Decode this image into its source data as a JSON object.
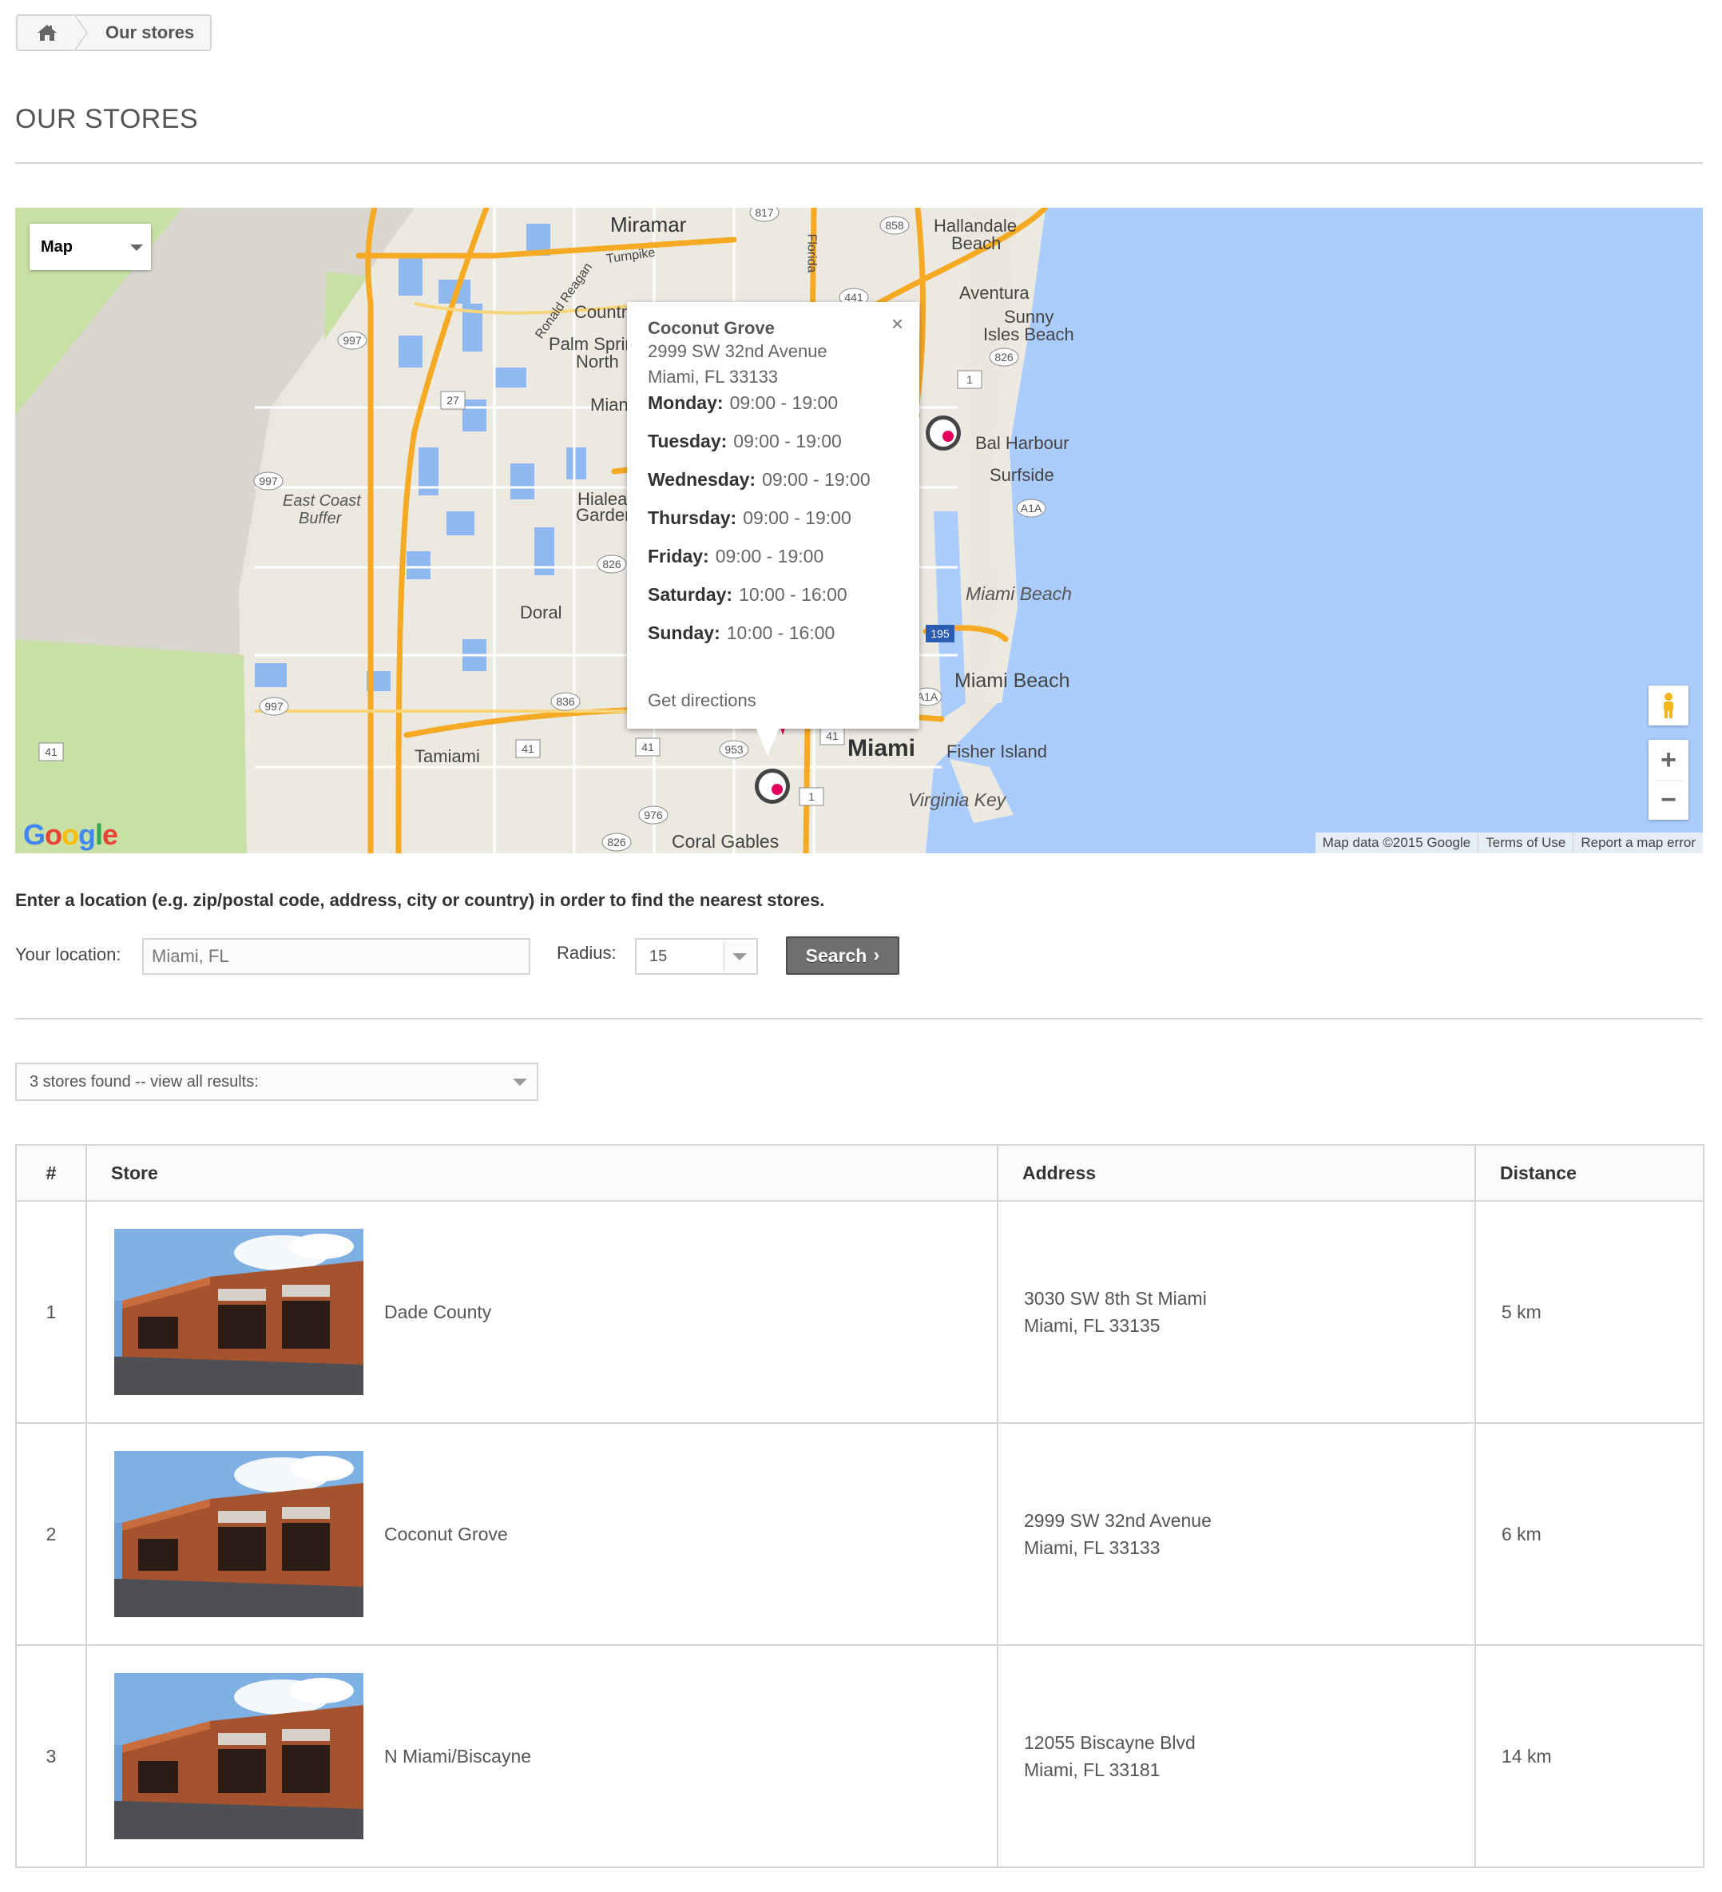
{
  "breadcrumb": {
    "home_icon": "home-icon",
    "current": "Our stores"
  },
  "page_title": "OUR STORES",
  "map": {
    "type_selector": "Map",
    "info_window": {
      "title": "Coconut Grove",
      "address_line1": "2999 SW 32nd Avenue",
      "address_line2": "Miami, FL 33133",
      "hours": [
        {
          "day": "Monday:",
          "time": "09:00 - 19:00"
        },
        {
          "day": "Tuesday:",
          "time": "09:00 - 19:00"
        },
        {
          "day": "Wednesday:",
          "time": "09:00 - 19:00"
        },
        {
          "day": "Thursday:",
          "time": "09:00 - 19:00"
        },
        {
          "day": "Friday:",
          "time": "09:00 - 19:00"
        },
        {
          "day": "Saturday:",
          "time": "10:00 - 16:00"
        },
        {
          "day": "Sunday:",
          "time": "10:00 - 16:00"
        }
      ],
      "directions": "Get directions",
      "close": "×"
    },
    "labels": {
      "miramar": "Miramar",
      "hallandale": "Hallandale",
      "hallandale_beach": "Beach",
      "aventura": "Aventura",
      "sunny": "Sunny",
      "isles_beach": "Isles Beach",
      "country": "Countr",
      "palm_spring": "Palm Sprin",
      "north": "North",
      "mia": "Mian",
      "east_coast": "East Coast",
      "buffer": "Buffer",
      "hialeah": "Hialea",
      "gardens": "Garden",
      "doral": "Doral",
      "bal_harbour": "Bal Harbour",
      "surfside": "Surfside",
      "miami_beach_1": "Miami Beach",
      "miami_beach_2": "Miami Beach",
      "tamiami": "Tamiami",
      "miami": "Miami",
      "fisher_island": "Fisher Island",
      "virginia_key": "Virginia Key",
      "coral_gables": "Coral Gables",
      "turnpike": "Turnpike",
      "ronald_reagan": "Ronald Reagan",
      "florida": "Florida"
    },
    "shields": [
      "817",
      "858",
      "441",
      "997",
      "27",
      "826",
      "1",
      "997",
      "826",
      "A1A",
      "195",
      "836",
      "997",
      "41",
      "41",
      "41",
      "953",
      "41",
      "976",
      "1",
      "826",
      "A1A"
    ],
    "zoom_in": "+",
    "zoom_out": "−",
    "google": "Google",
    "footer": [
      "Map data ©2015 Google",
      "Terms of Use",
      "Report a map error"
    ]
  },
  "search": {
    "instructions": "Enter a location (e.g. zip/postal code, address, city or country) in order to find the nearest stores.",
    "location_label": "Your location:",
    "location_value": "Miami, FL",
    "radius_label": "Radius:",
    "radius_value": "15",
    "button": "Search"
  },
  "results_select": "3 stores found -- view all results:",
  "table": {
    "headers": [
      "#",
      "Store",
      "Address",
      "Distance"
    ],
    "rows": [
      {
        "num": "1",
        "store": "Dade County",
        "addr1": "3030 SW 8th St Miami",
        "addr2": "Miami, FL 33135",
        "distance": "5 km"
      },
      {
        "num": "2",
        "store": "Coconut Grove",
        "addr1": "2999 SW 32nd Avenue",
        "addr2": "Miami, FL 33133",
        "distance": "6 km"
      },
      {
        "num": "3",
        "store": "N Miami/Biscayne",
        "addr1": "12055 Biscayne Blvd",
        "addr2": "Miami, FL 33181",
        "distance": "14 km"
      }
    ]
  },
  "colors": {
    "water": "#abcdfe",
    "land": "#ebe7dd",
    "park": "#c8dfa5",
    "highway": "#f6aa24",
    "button": "#6f6f6f",
    "border": "#d6d4d4"
  }
}
